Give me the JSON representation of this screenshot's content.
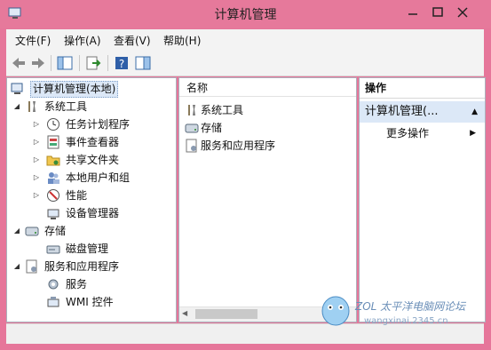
{
  "window": {
    "title": "计算机管理"
  },
  "menu": [
    "文件(F)",
    "操作(A)",
    "查看(V)",
    "帮助(H)"
  ],
  "tree": {
    "root": "计算机管理(本地)",
    "items": [
      {
        "label": "系统工具",
        "level": 1,
        "icon": "tools-icon"
      },
      {
        "label": "任务计划程序",
        "level": 2,
        "icon": "clock-icon"
      },
      {
        "label": "事件查看器",
        "level": 2,
        "icon": "event-viewer-icon"
      },
      {
        "label": "共享文件夹",
        "level": 2,
        "icon": "shared-folder-icon"
      },
      {
        "label": "本地用户和组",
        "level": 2,
        "icon": "users-icon"
      },
      {
        "label": "性能",
        "level": 2,
        "icon": "performance-icon"
      },
      {
        "label": "设备管理器",
        "level": 2,
        "icon": "device-manager-icon"
      },
      {
        "label": "存储",
        "level": 1,
        "icon": "storage-icon"
      },
      {
        "label": "磁盘管理",
        "level": 2,
        "icon": "disk-icon"
      },
      {
        "label": "服务和应用程序",
        "level": 1,
        "icon": "services-apps-icon"
      },
      {
        "label": "服务",
        "level": 2,
        "icon": "gear-icon"
      },
      {
        "label": "WMI 控件",
        "level": 2,
        "icon": "wmi-icon"
      }
    ]
  },
  "list": {
    "header": "名称",
    "items": [
      "系统工具",
      "存储",
      "服务和应用程序"
    ]
  },
  "actions": {
    "title": "操作",
    "group": "计算机管理(...",
    "more": "更多操作"
  },
  "watermark": {
    "line1": "ZOL 太平洋电脑网论坛",
    "line2": "wangxinai.2345.cn"
  },
  "colors": {
    "titlebar": "#e6799b",
    "selection": "#dce8f7"
  }
}
